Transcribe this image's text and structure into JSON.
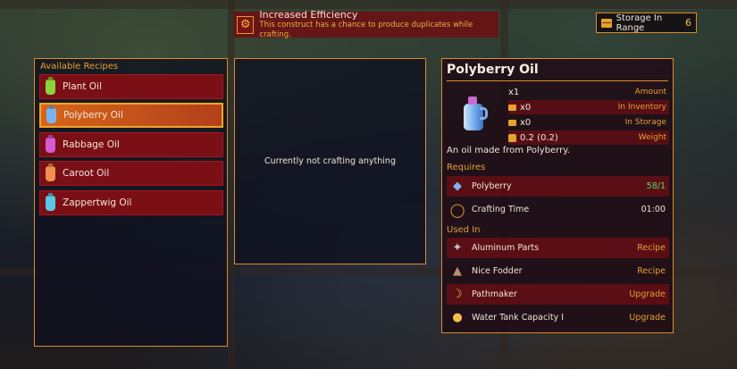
{
  "banner": {
    "title": "Increased Efficiency",
    "description": "This construct has a chance to produce duplicates while crafting.",
    "icon": "gear-cog-icon"
  },
  "storage": {
    "label": "Storage In Range",
    "count": "6",
    "icon": "storage-chest-icon"
  },
  "recipes": {
    "title": "Available Recipes",
    "items": [
      {
        "label": "Plant Oil",
        "color": "#8cd23a",
        "icon": "oil-bottle-icon"
      },
      {
        "label": "Polyberry Oil",
        "color": "#7ab4f0",
        "icon": "oil-bottle-icon",
        "selected": true
      },
      {
        "label": "Rabbage Oil",
        "color": "#d85ad2",
        "icon": "oil-bottle-icon"
      },
      {
        "label": "Caroot Oil",
        "color": "#f0904a",
        "icon": "oil-bottle-icon"
      },
      {
        "label": "Zappertwig Oil",
        "color": "#5ac8e6",
        "icon": "oil-bottle-icon"
      }
    ]
  },
  "crafting": {
    "status": "Currently not crafting anything"
  },
  "detail": {
    "title": "Polyberry Oil",
    "stats": [
      {
        "value": "x1",
        "label": "Amount"
      },
      {
        "value": "x0",
        "label": "In Inventory",
        "icon": "inventory-icon"
      },
      {
        "value": "x0",
        "label": "In Storage",
        "icon": "storage-icon"
      },
      {
        "value": "0.2 (0.2)",
        "label": "Weight",
        "icon": "weight-icon"
      }
    ],
    "description": "An oil made from Polyberry.",
    "requires_label": "Requires",
    "requires": [
      {
        "name": "Polyberry",
        "value": "58/1",
        "icon": "polyberry-icon"
      },
      {
        "name": "Crafting Time",
        "value": "01:00",
        "icon": "clock-icon"
      }
    ],
    "used_in_label": "Used In",
    "used_in": [
      {
        "name": "Aluminum Parts",
        "type": "Recipe",
        "icon": "aluminum-parts-icon"
      },
      {
        "name": "Nice Fodder",
        "type": "Recipe",
        "icon": "fodder-icon"
      },
      {
        "name": "Pathmaker",
        "type": "Upgrade",
        "icon": "pathmaker-icon"
      },
      {
        "name": "Water Tank Capacity I",
        "type": "Upgrade",
        "icon": "water-tank-icon"
      }
    ]
  }
}
